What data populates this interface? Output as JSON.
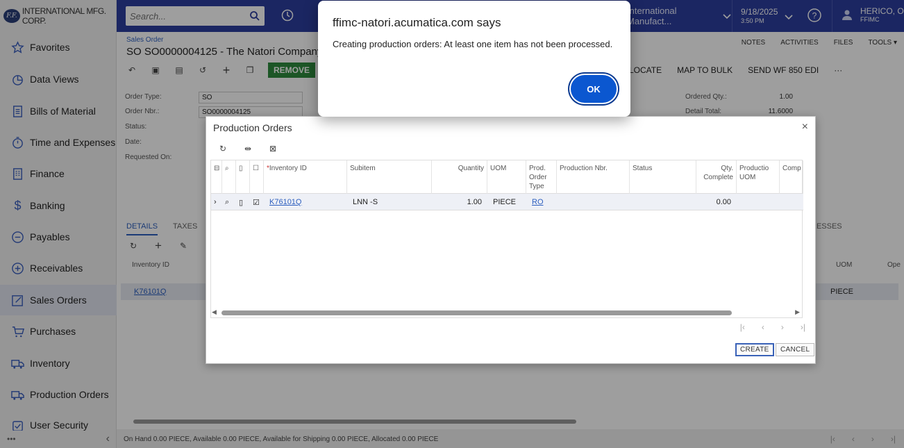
{
  "browser_alert": {
    "title": "ffimc-natori.acumatica.com says",
    "message": "Creating production orders: At least one item has not been processed.",
    "ok_label": "OK"
  },
  "sidebar": {
    "logo_badge": "F.F.",
    "logo_text": "INTERNATIONAL MFG. CORP.",
    "items": [
      {
        "label": "Favorites",
        "icon": "star-icon"
      },
      {
        "label": "Data Views",
        "icon": "pie-chart-icon"
      },
      {
        "label": "Bills of Material",
        "icon": "document-list-icon"
      },
      {
        "label": "Time and Expenses",
        "icon": "stopwatch-icon"
      },
      {
        "label": "Finance",
        "icon": "ledger-icon"
      },
      {
        "label": "Banking",
        "icon": "dollar-icon"
      },
      {
        "label": "Payables",
        "icon": "minus-circle-icon"
      },
      {
        "label": "Receivables",
        "icon": "plus-circle-icon"
      },
      {
        "label": "Sales Orders",
        "icon": "pencil-square-icon",
        "active": true
      },
      {
        "label": "Purchases",
        "icon": "cart-icon"
      },
      {
        "label": "Inventory",
        "icon": "truck-icon"
      },
      {
        "label": "Production Orders",
        "icon": "truck-icon"
      },
      {
        "label": "User Security",
        "icon": "shield-check-icon"
      }
    ],
    "footer_more": "•••",
    "footer_collapse": "‹"
  },
  "header": {
    "search_placeholder": "Search...",
    "company": "International Manufact...",
    "date": "9/18/2025",
    "time": "3:50 PM",
    "user_name": "HERICO, O",
    "user_company": "FFIMC"
  },
  "page": {
    "breadcrumb": "Sales Order",
    "title": "SO SO0000004125 - The Natori Company",
    "links": [
      "NOTES",
      "ACTIVITIES",
      "FILES",
      "TOOLS ▾"
    ],
    "toolbar_green": "REMOVE",
    "toolbar_right": [
      "LOCATE",
      "MAP TO BULK",
      "SEND WF 850 EDI",
      "···"
    ],
    "form": {
      "order_type_label": "Order Type:",
      "order_type_value": "SO",
      "order_nbr_label": "Order Nbr.:",
      "order_nbr_value": "SO0000004125",
      "status_label": "Status:",
      "date_label": "Date:",
      "requested_on_label": "Requested On:",
      "ordered_qty_label": "Ordered Qty.:",
      "ordered_qty_value": "1.00",
      "detail_total_label": "Detail Total:",
      "detail_total_value": "11.6000"
    },
    "tabs": [
      "DETAILS",
      "TAXES"
    ],
    "tab_addresses": "RESSES",
    "grid": {
      "col_inventory": "Inventory ID",
      "col_uom": "UOM",
      "col_ope": "Ope",
      "row_inventory": "K76101Q",
      "row_uom": "PIECE"
    },
    "status_line": "On Hand 0.00 PIECE, Available 0.00 PIECE, Available for Shipping 0.00 PIECE, Allocated 0.00 PIECE",
    "pager": [
      "|‹",
      "‹",
      "›",
      "›|"
    ]
  },
  "production_dialog": {
    "title": "Production Orders",
    "close": "×",
    "columns": {
      "inventory_id": "Inventory ID",
      "subitem": "Subitem",
      "quantity": "Quantity",
      "uom": "UOM",
      "prod_order_type": "Prod. Order Type",
      "production_nbr": "Production Nbr.",
      "status": "Status",
      "qty_complete": "Qty. Complete",
      "production_uom": "Productio UOM",
      "comp": "Comp"
    },
    "rows": [
      {
        "inventory_id": "K76101Q",
        "subitem": "LNN -S",
        "quantity": "1.00",
        "uom": "PIECE",
        "prod_order_type": "RO",
        "production_nbr": "",
        "status": "",
        "qty_complete": "0.00"
      }
    ],
    "pager": [
      "|‹",
      "‹",
      "›",
      "›|"
    ],
    "create_label": "CREATE",
    "cancel_label": "CANCEL"
  }
}
